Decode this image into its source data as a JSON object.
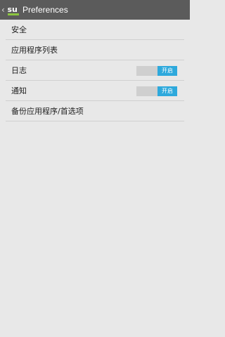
{
  "header": {
    "title": "Preferences",
    "logo_text": "su"
  },
  "colors": {
    "action_bar": "#5b5b5b",
    "background": "#e8e8e8",
    "toggle_on": "#2ea9dc",
    "toggle_off": "#cfcfcf"
  },
  "preferences": {
    "items": [
      {
        "label": "安全"
      },
      {
        "label": "应用程序列表"
      },
      {
        "label": "日志",
        "toggle": {
          "state": "on",
          "label": "开启"
        }
      },
      {
        "label": "通知",
        "toggle": {
          "state": "on",
          "label": "开启"
        }
      },
      {
        "label": "备份应用程序/首选项"
      }
    ]
  }
}
